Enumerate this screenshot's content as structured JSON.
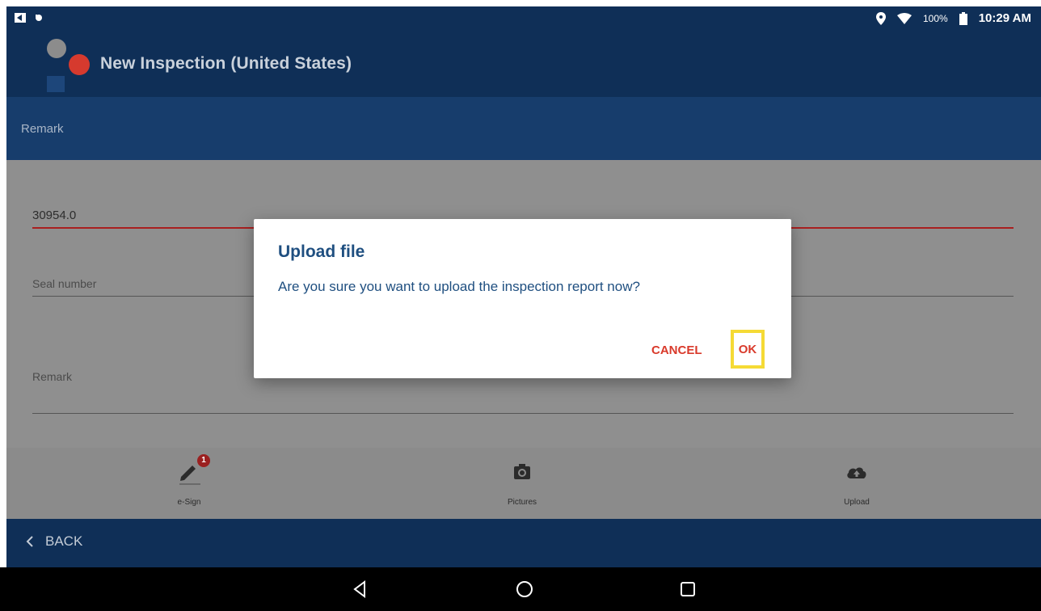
{
  "status_bar": {
    "battery": "100%",
    "time": "10:29 AM",
    "icons": [
      "notification-icon",
      "android-icon",
      "location-icon",
      "wifi-icon",
      "battery-icon"
    ]
  },
  "app_bar": {
    "title": "New Inspection (United States)"
  },
  "sub_bar": {
    "title": "Remark"
  },
  "form": {
    "field1_value": "30954.0",
    "seal_placeholder": "Seal number",
    "remark_placeholder": "Remark"
  },
  "tabs": [
    {
      "label": "e-Sign",
      "icon": "pen-icon",
      "badge": "1"
    },
    {
      "label": "Pictures",
      "icon": "camera-icon"
    },
    {
      "label": "Upload",
      "icon": "cloud-upload-icon"
    }
  ],
  "back": {
    "label": "BACK"
  },
  "dialog": {
    "title": "Upload file",
    "message": "Are you sure you want to upload the inspection report now?",
    "cancel_label": "CANCEL",
    "ok_label": "OK"
  },
  "colors": {
    "app_bar": "#0f2f57",
    "dialog_text": "#1f4f80",
    "button_text": "#d93a2b",
    "highlight": "#f5da35"
  }
}
